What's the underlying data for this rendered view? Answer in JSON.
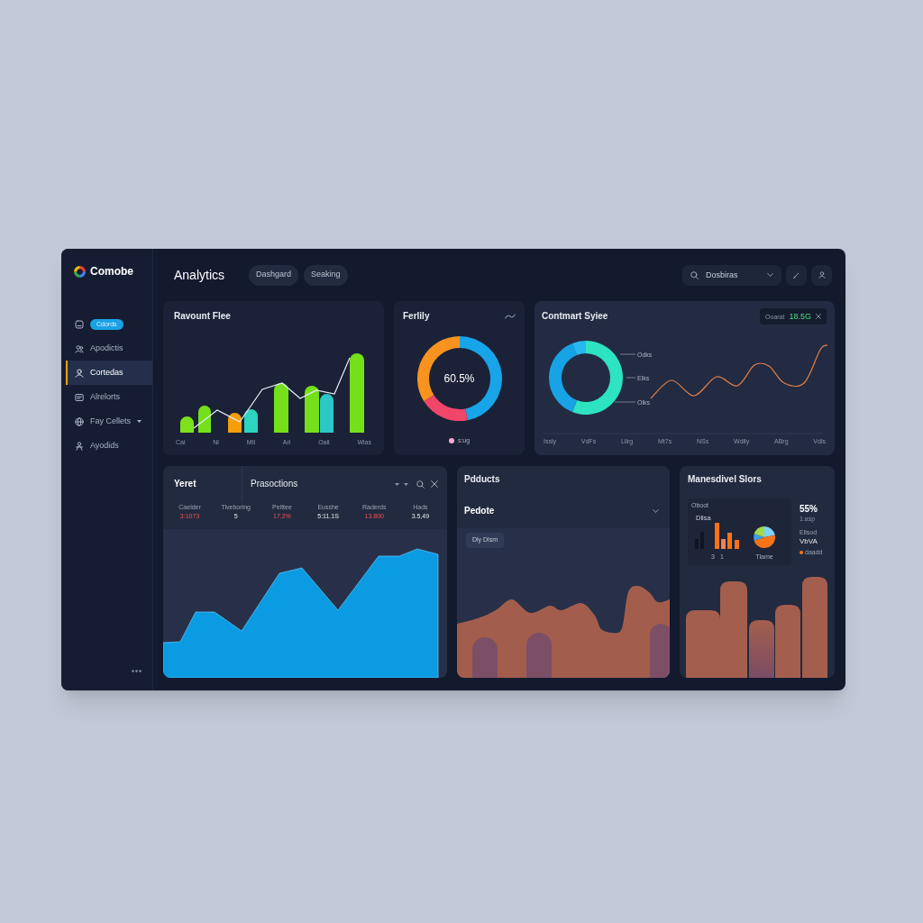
{
  "logo": {
    "text": "Comobe"
  },
  "sidebar": {
    "items": [
      {
        "kind": "badge",
        "label": "Cdords",
        "selected": false
      },
      {
        "kind": "link",
        "label": "Apodictis",
        "selected": false
      },
      {
        "kind": "link",
        "label": "Cortedas",
        "selected": true
      },
      {
        "kind": "link",
        "label": "Alrelorts",
        "selected": false
      },
      {
        "kind": "dropdown",
        "label": "Fay Cellets",
        "selected": false
      },
      {
        "kind": "link",
        "label": "Ayodids",
        "selected": false
      }
    ]
  },
  "header": {
    "title": "Analytics",
    "tabs": [
      {
        "label": "Dashgard",
        "selected": false
      },
      {
        "label": "Seaking",
        "selected": false
      }
    ],
    "filter_select": {
      "value": "Dosbiras"
    }
  },
  "revenue_card": {
    "title": "Ravount Flee",
    "x_labels": [
      "Cal",
      "Nl",
      "Mtl",
      "Arl",
      "Oall",
      "Wlas"
    ]
  },
  "ferlily_card": {
    "title": "Ferlily",
    "center_value": "60.5%",
    "legend": [
      {
        "label": "s:ug",
        "color": "#f9a8d4"
      }
    ]
  },
  "contract_card": {
    "title": "Contmart Syiee",
    "tag": {
      "label": "Ooarat",
      "value": "18.5G"
    },
    "donut_labels": [
      "Odks",
      "Elks",
      "Olks"
    ],
    "x_labels": [
      "Issly",
      "VdFs",
      "Lllrg",
      "Mt7s",
      "NSs",
      "Wdlly",
      "ABrg",
      "Vdls"
    ]
  },
  "transactions_card": {
    "tab": "Yeret",
    "title": "Prasoctions",
    "stats": [
      {
        "label": "Caelder",
        "value": "3:1073",
        "negative": true
      },
      {
        "label": "Tiveboring",
        "value": "5",
        "negative": false
      },
      {
        "label": "Pelttee",
        "value": "17.2%",
        "negative": true
      },
      {
        "label": "Eusshe",
        "value": "5:11.1S",
        "negative": false
      },
      {
        "label": "Raderds",
        "value": "13.800",
        "negative": true
      },
      {
        "label": "Hads",
        "value": "3.5,49",
        "negative": false
      }
    ]
  },
  "products_card": {
    "title": "Pdducts",
    "section": {
      "label": "Pedote",
      "expanded": false
    },
    "chip": "Dly Dlsm"
  },
  "sales_card": {
    "title": "Manesdivel Slors",
    "inset": {
      "title": "Oboot",
      "subtitle": "Dlisa",
      "axis_labels": [
        "3",
        "1"
      ],
      "pie_label": "Tlame"
    },
    "kpi": {
      "value": "55%",
      "caption": "1:asp"
    },
    "metric": {
      "caption": "Ellsod",
      "value": "VbVA"
    },
    "legend": [
      {
        "label": "daadd",
        "color": "#f97316"
      }
    ]
  }
}
